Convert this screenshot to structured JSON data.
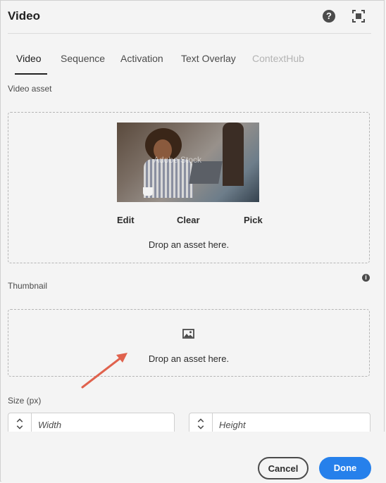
{
  "header": {
    "title": "Video",
    "help_glyph": "?"
  },
  "tabs": [
    {
      "label": "Video",
      "active": true,
      "disabled": false
    },
    {
      "label": "Sequence",
      "active": false,
      "disabled": false
    },
    {
      "label": "Activation",
      "active": false,
      "disabled": false
    },
    {
      "label": "Text Overlay",
      "active": false,
      "disabled": false
    },
    {
      "label": "ContextHub",
      "active": false,
      "disabled": true
    }
  ],
  "video_asset": {
    "label": "Video asset",
    "thumbnail_watermark": "Adobe Stock",
    "actions": {
      "edit": "Edit",
      "clear": "Clear",
      "pick": "Pick"
    },
    "drop_text": "Drop an asset here."
  },
  "thumbnail": {
    "label": "Thumbnail",
    "info_glyph": "i",
    "icon": "image-icon",
    "drop_text": "Drop an asset here."
  },
  "size": {
    "label": "Size (px)",
    "width_placeholder": "Width",
    "height_placeholder": "Height"
  },
  "footer": {
    "cancel_label": "Cancel",
    "done_label": "Done"
  },
  "colors": {
    "accent": "#2680eb",
    "annotation_arrow": "#e0624d"
  }
}
